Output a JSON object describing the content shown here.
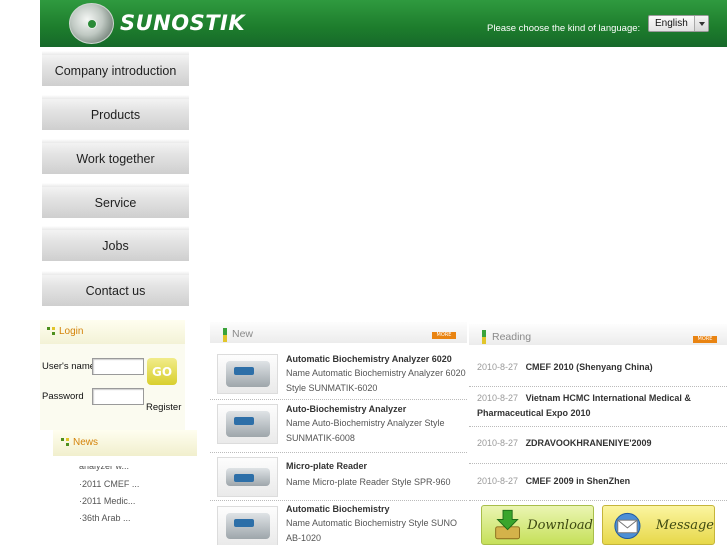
{
  "header": {
    "logo_text": "SUNOSTIK",
    "language_prompt": "Please choose the kind of language:",
    "language_selected": "English"
  },
  "nav": [
    {
      "label": "Company introduction"
    },
    {
      "label": "Products"
    },
    {
      "label": "Work together"
    },
    {
      "label": "Service"
    },
    {
      "label": "Jobs"
    },
    {
      "label": "Contact us"
    }
  ],
  "login": {
    "title": "Login",
    "username_label": "User's name",
    "password_label": "Password",
    "go_label": "GO",
    "register_label": "Register"
  },
  "news": {
    "title": "News",
    "items": [
      "analyzer w...",
      "·2011 CMEF ...",
      "·2011 Medic...",
      "·36th Arab ..."
    ]
  },
  "new_panel": {
    "title": "New",
    "more_label": "MORE",
    "products": [
      {
        "title": "Automatic Biochemistry Analyzer 6020",
        "desc": "Name Automatic Biochemistry Analyzer 6020 Style SUNMATIK-6020"
      },
      {
        "title": "Auto-Biochemistry Analyzer",
        "desc": "Name Auto-Biochemistry Analyzer Style  SUNMATIK-6008"
      },
      {
        "title": "Micro-plate Reader",
        "desc": "Name Micro-plate Reader Style SPR-960"
      },
      {
        "title": "Automatic Biochemistry",
        "desc": "Name Automatic Biochemistry Style SUNO AB-1020"
      }
    ]
  },
  "reading_panel": {
    "title": "Reading",
    "more_label": "MORE",
    "items": [
      {
        "date": "2010-8-27",
        "title": "CMEF 2010 (Shenyang China)"
      },
      {
        "date": "2010-8-27",
        "title": "Vietnam HCMC International Medical & Pharmaceutical Expo 2010"
      },
      {
        "date": "2010-8-27",
        "title": "ZDRAVOOKHRANENIYE'2009"
      },
      {
        "date": "2010-8-27",
        "title": "CMEF 2009 in ShenZhen"
      }
    ]
  },
  "buttons": {
    "download_label": "Download",
    "message_label": "Message"
  },
  "colors": {
    "header_green": "#1d7c2c",
    "accent_orange": "#d4830a",
    "more_badge": "#e98412"
  }
}
